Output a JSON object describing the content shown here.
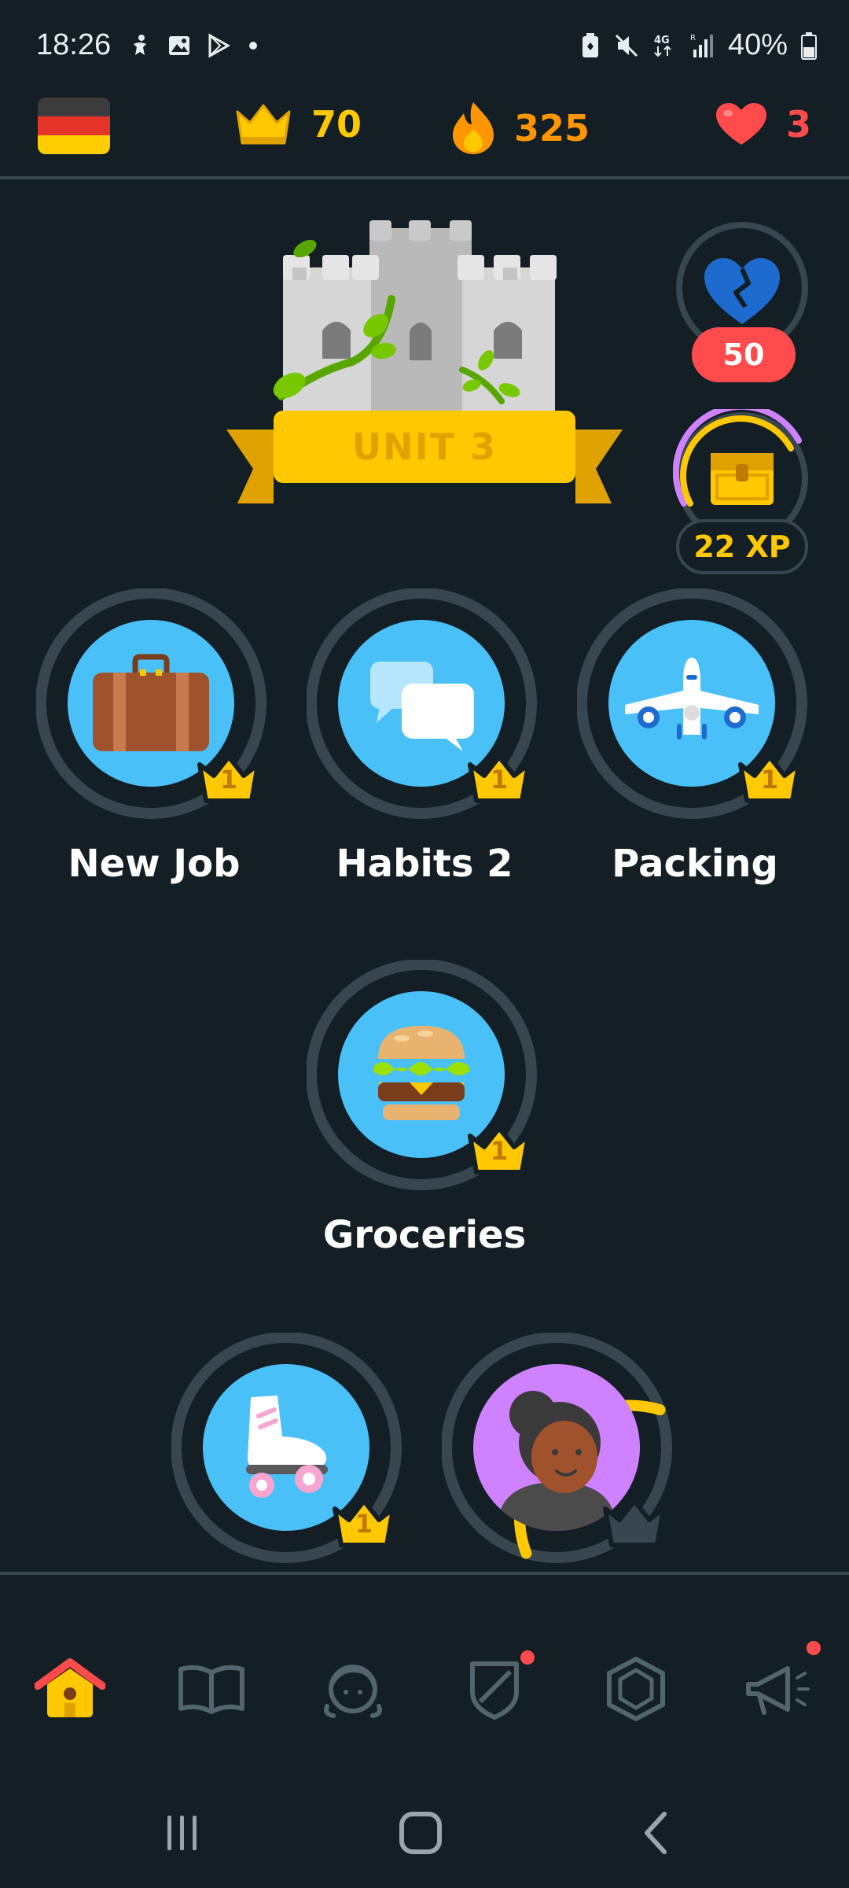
{
  "status_bar": {
    "time": "18:26",
    "battery": "40%",
    "network": "4G"
  },
  "top_bar": {
    "language_flag": "germany-flag",
    "crowns": "70",
    "streak": "325",
    "hearts": "3"
  },
  "unit": {
    "label": "UNIT 3"
  },
  "side": {
    "broken_heart_count": "50",
    "xp_label": "22 XP"
  },
  "skills": [
    {
      "title": "New Job",
      "crown_level": "1",
      "icon": "briefcase-icon"
    },
    {
      "title": "Habits 2",
      "crown_level": "1",
      "icon": "speech-bubbles-icon"
    },
    {
      "title": "Packing",
      "crown_level": "1",
      "icon": "airplane-icon"
    },
    {
      "title": "Groceries",
      "crown_level": "1",
      "icon": "burger-icon"
    },
    {
      "title": "",
      "crown_level": "1",
      "icon": "roller-skate-icon"
    },
    {
      "title": "",
      "crown_level": "",
      "icon": "character-avatar-icon",
      "progress": 0.35
    }
  ],
  "bottom_nav": {
    "items": [
      "home",
      "stories",
      "profile",
      "leagues",
      "shop",
      "news"
    ],
    "active": "home"
  },
  "colors": {
    "background": "#131f24",
    "divider": "#37464f",
    "gold": "#ffc800",
    "orange": "#ff9600",
    "red": "#ff4b4b",
    "skill_blue": "#49c0f8",
    "purple": "#ce82ff"
  }
}
